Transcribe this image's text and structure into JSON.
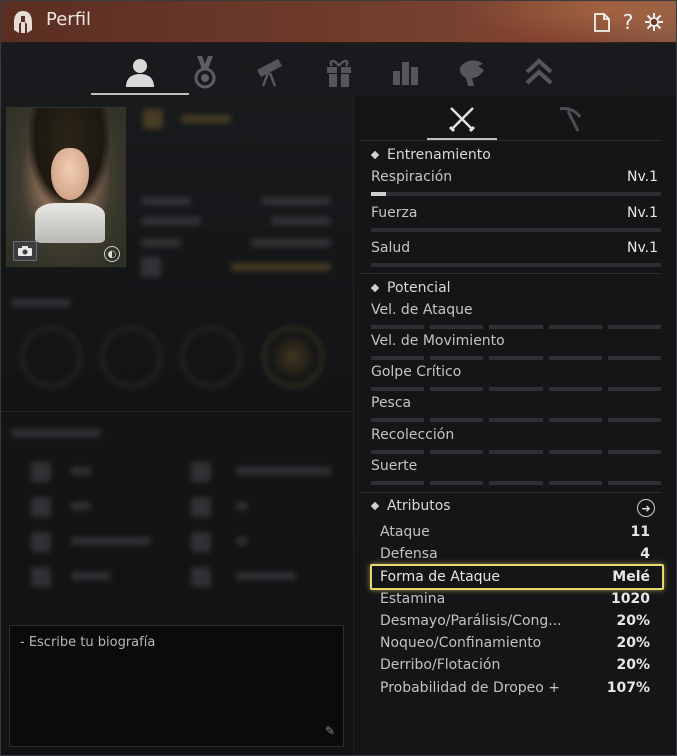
{
  "window": {
    "title": "Perfil"
  },
  "titlebar_buttons": [
    {
      "name": "document-icon",
      "glyph": "🗋"
    },
    {
      "name": "help-icon",
      "glyph": "?"
    },
    {
      "name": "settings-icon",
      "glyph": "✵"
    }
  ],
  "main_tabs": [
    {
      "name": "tab-profile-icon",
      "active": true
    },
    {
      "name": "tab-medal-icon",
      "active": false
    },
    {
      "name": "tab-telescope-icon",
      "active": false
    },
    {
      "name": "tab-gift-icon",
      "active": false
    },
    {
      "name": "tab-stats-icon",
      "active": false
    },
    {
      "name": "tab-pet-icon",
      "active": false
    },
    {
      "name": "tab-rank-icon",
      "active": false
    }
  ],
  "biography": {
    "placeholder": "- Escribe tu biografía"
  },
  "right_tabs": [
    {
      "name": "tab-combat-icon",
      "active": true
    },
    {
      "name": "tab-gathering-icon",
      "active": false
    }
  ],
  "training": {
    "heading": "Entrenamiento",
    "rows": [
      {
        "label": "Respiración",
        "value": "Nv.1",
        "progress": 0.05
      },
      {
        "label": "Fuerza",
        "value": "Nv.1",
        "progress": 0
      },
      {
        "label": "Salud",
        "value": "Nv.1",
        "progress": 0
      }
    ]
  },
  "potential": {
    "heading": "Potencial",
    "rows": [
      {
        "label": "Vel. de Ataque",
        "filled": 0
      },
      {
        "label": "Vel. de Movimiento",
        "filled": 0
      },
      {
        "label": "Golpe Crítico",
        "filled": 0
      },
      {
        "label": "Pesca",
        "filled": 0
      },
      {
        "label": "Recolección",
        "filled": 0
      },
      {
        "label": "Suerte",
        "filled": 0
      }
    ]
  },
  "attributes": {
    "heading": "Atributos",
    "rows": [
      {
        "label": "Ataque",
        "value": "11"
      },
      {
        "label": "Defensa",
        "value": "4"
      },
      {
        "label": "Forma de Ataque",
        "value": "Melé"
      },
      {
        "label": "Estamina",
        "value": "1020"
      },
      {
        "label": "Desmayo/Parálisis/Cong...",
        "value": "20%"
      },
      {
        "label": "Noqueo/Confinamiento",
        "value": "20%"
      },
      {
        "label": "Derribo/Flotación",
        "value": "20%"
      },
      {
        "label": "Probabilidad de Dropeo +",
        "value": "107%"
      }
    ]
  }
}
